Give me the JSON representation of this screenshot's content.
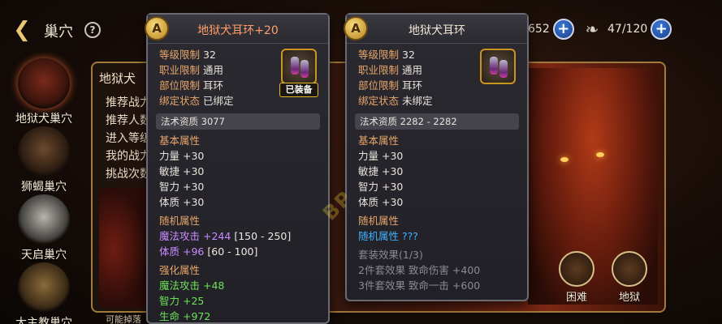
{
  "topbar": {
    "title": "巢穴",
    "help": "?",
    "resource1_value": "652",
    "resource2_value": "47/120",
    "plus": "+"
  },
  "sidebar": {
    "items": [
      {
        "label": "地狱犬巢穴"
      },
      {
        "label": "狮蝎巢穴"
      },
      {
        "label": "天启巢穴"
      },
      {
        "label": "大主教巢穴"
      }
    ]
  },
  "background_panel": {
    "header": "地狱犬",
    "rows": [
      "推荐战力",
      "推荐人数",
      "进入等级",
      "我的战力",
      "挑战次数"
    ],
    "footer": "可能掉落",
    "difficulties": [
      "困难",
      "地狱"
    ]
  },
  "tooltip_equipped": {
    "grade": "A",
    "title": "地狱犬耳环+20",
    "badge": "已装备",
    "level_label": "等级限制",
    "level_value": "32",
    "class_label": "职业限制",
    "class_value": "通用",
    "slot_label": "部位限制",
    "slot_value": "耳环",
    "bind_label": "绑定状态",
    "bind_value": "已绑定",
    "quality": "法术资质  3077",
    "base_header": "基本属性",
    "base": [
      "力量 +30",
      "敏捷 +30",
      "智力 +30",
      "体质 +30"
    ],
    "random_header": "随机属性",
    "random": [
      {
        "name": "魔法攻击",
        "val": "+244",
        "range": "[150 - 250]"
      },
      {
        "name": "体质",
        "val": "+96",
        "range": "[60 - 100]"
      }
    ],
    "enhance_header": "强化属性",
    "enhance": [
      "魔法攻击 +48",
      "智力 +25",
      "生命 +972"
    ]
  },
  "tooltip_compare": {
    "grade": "A",
    "title": "地狱犬耳环",
    "level_label": "等级限制",
    "level_value": "32",
    "class_label": "职业限制",
    "class_value": "通用",
    "slot_label": "部位限制",
    "slot_value": "耳环",
    "bind_label": "绑定状态",
    "bind_value": "未绑定",
    "quality": "法术资质  2282 - 2282",
    "base_header": "基本属性",
    "base": [
      "力量 +30",
      "敏捷 +30",
      "智力 +30",
      "体质 +30"
    ],
    "random_header": "随机属性",
    "random_line": "随机属性 ???",
    "set_header": "套装效果(1/3)",
    "set": [
      "2件套效果 致命伤害 +400",
      "3件套效果 致命一击 +600"
    ]
  },
  "colors": {
    "orange_label": "#e8a66a",
    "green_stat": "#6ee05a",
    "purple_stat": "#c98bff",
    "blue_unknown": "#3fb0ff",
    "title_orange": "#ff9e6a"
  }
}
